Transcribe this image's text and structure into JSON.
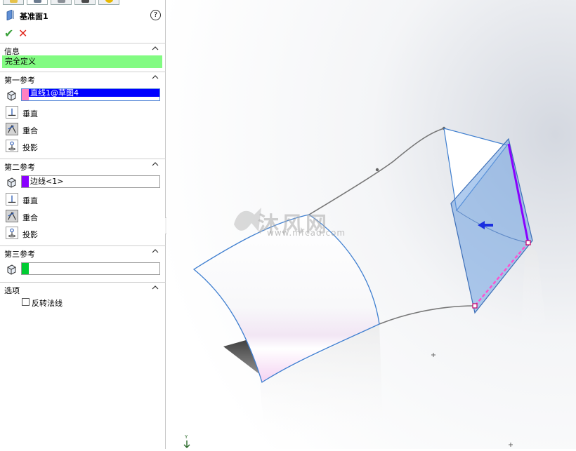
{
  "property_manager": {
    "feature_title": "基准面1",
    "help_icon": "?",
    "ok_icon": "✔",
    "cancel_icon": "✕",
    "tab_icons": [
      "feature-manager-icon",
      "property-manager-icon",
      "configuration-manager-icon",
      "dimxpert-icon",
      "appearance-icon"
    ],
    "info": {
      "header": "信息",
      "message": "完全定义",
      "message_color": "#82fb82"
    },
    "first_reference": {
      "header": "第一参考",
      "selection": "直线1@草图4",
      "swatch_color": "#ff80c0",
      "highlight_color": "#0000ff",
      "options": [
        "垂直",
        "重合",
        "投影"
      ],
      "active_option": "重合"
    },
    "second_reference": {
      "header": "第二参考",
      "selection": "边线<1>",
      "swatch_color": "#8a00ff",
      "options": [
        "垂直",
        "重合",
        "投影"
      ],
      "active_option": "重合"
    },
    "third_reference": {
      "header": "第三参考",
      "selection": "",
      "swatch_color": "#00cc33"
    },
    "options": {
      "header": "选项",
      "flip_normal_label": "反转法线",
      "flip_normal_checked": false
    }
  },
  "viewport": {
    "watermark_brand": "沐风网",
    "watermark_url": "www.mfcad.com",
    "axis_y_label": "Y",
    "plane_color": "#6ea0e0",
    "sketch_line_color": "#ff4fd0"
  }
}
